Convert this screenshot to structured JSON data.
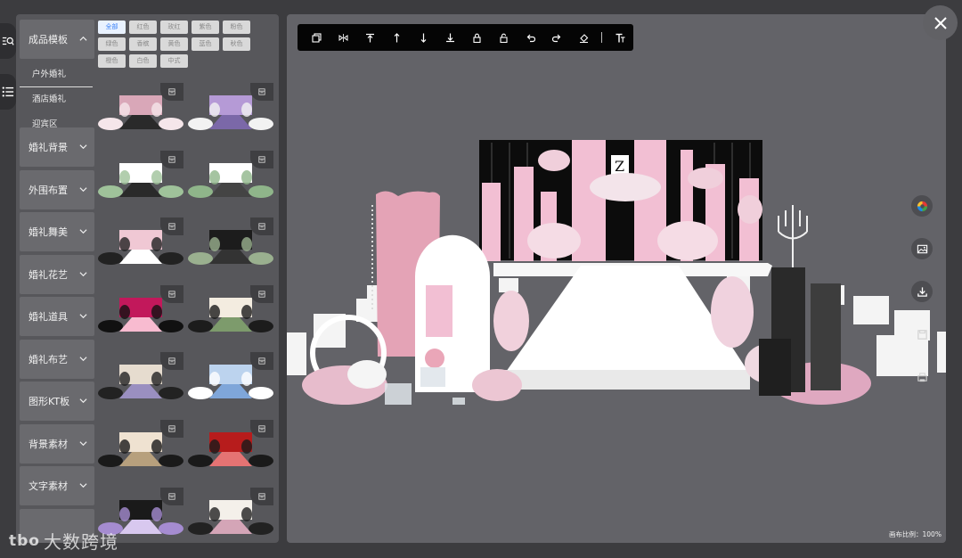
{
  "sidebar_rail": {
    "items": [
      {
        "icon": "search-list-icon"
      },
      {
        "icon": "list-icon"
      }
    ]
  },
  "categories": [
    {
      "label": "成品模板",
      "expanded": true,
      "subitems": [
        "户外婚礼",
        "酒店婚礼",
        "迎宾区"
      ],
      "active_sub": "户外婚礼"
    },
    {
      "label": "婚礼背景"
    },
    {
      "label": "外围布置"
    },
    {
      "label": "婚礼舞美"
    },
    {
      "label": "婚礼花艺"
    },
    {
      "label": "婚礼道具"
    },
    {
      "label": "婚礼布艺"
    },
    {
      "label": "图形KT板"
    },
    {
      "label": "背景素材"
    },
    {
      "label": "文字素材"
    }
  ],
  "color_tags": [
    "全部",
    "红色",
    "玫红",
    "紫色",
    "粉色",
    "绿色",
    "香槟",
    "黄色",
    "蓝色",
    "秋色",
    "橙色",
    "白色",
    "中式"
  ],
  "selected_tag": "全部",
  "thumbnails": [
    {
      "palette": [
        "#d9a7b8",
        "#f5e6ea",
        "#2a2a2a"
      ]
    },
    {
      "palette": [
        "#b59ad6",
        "#f2f2f2",
        "#7b68a8"
      ]
    },
    {
      "palette": [
        "#ffffff",
        "#9fc29a",
        "#2a2a2a"
      ]
    },
    {
      "palette": [
        "#ffffff",
        "#8fb58a",
        "#444444"
      ]
    },
    {
      "palette": [
        "#f0c8d4",
        "#222222",
        "#ffffff"
      ]
    },
    {
      "palette": [
        "#1c1c1c",
        "#9ab08f",
        "#333333"
      ]
    },
    {
      "palette": [
        "#c2185b",
        "#111111",
        "#f8bbd0"
      ]
    },
    {
      "palette": [
        "#f3ece0",
        "#1c1c1c",
        "#7d9b6c"
      ]
    },
    {
      "palette": [
        "#e6dccf",
        "#222222",
        "#9a8fc0"
      ]
    },
    {
      "palette": [
        "#bcd3ee",
        "#ffffff",
        "#7fa6d9"
      ]
    },
    {
      "palette": [
        "#efe2d1",
        "#1a1a1a",
        "#b7a07d"
      ]
    },
    {
      "palette": [
        "#b71c1c",
        "#1a1a1a",
        "#e57373"
      ]
    },
    {
      "palette": [
        "#1a1a1a",
        "#a58cd1",
        "#d8c8ef"
      ]
    },
    {
      "palette": [
        "#f4f0ea",
        "#222222",
        "#d4a5b7"
      ]
    }
  ],
  "toolbar": {
    "tools": [
      {
        "name": "copy-icon"
      },
      {
        "name": "flip-horizontal-icon"
      },
      {
        "name": "bring-to-front-icon"
      },
      {
        "name": "move-up-icon"
      },
      {
        "name": "move-down-icon"
      },
      {
        "name": "send-to-back-icon"
      },
      {
        "name": "lock-icon"
      },
      {
        "name": "unlock-icon"
      },
      {
        "name": "undo-icon"
      },
      {
        "name": "redo-icon"
      },
      {
        "name": "clear-icon"
      },
      {
        "name": "text-icon"
      }
    ]
  },
  "right_tools": [
    {
      "name": "color-palette-icon"
    },
    {
      "name": "image-icon"
    },
    {
      "name": "download-icon"
    },
    {
      "name": "save-icon"
    },
    {
      "name": "print-icon"
    }
  ],
  "canvas": {
    "ratio_label": "画布比例：",
    "ratio_value": "100%"
  },
  "watermark": {
    "logo": "tbo",
    "text": "大数跨境"
  },
  "colors": {
    "bg": "#3c3c3f",
    "panel": "#57575b",
    "canvas": "#636368",
    "accent": "#3b82f6",
    "pink": "#f2bfd3"
  }
}
